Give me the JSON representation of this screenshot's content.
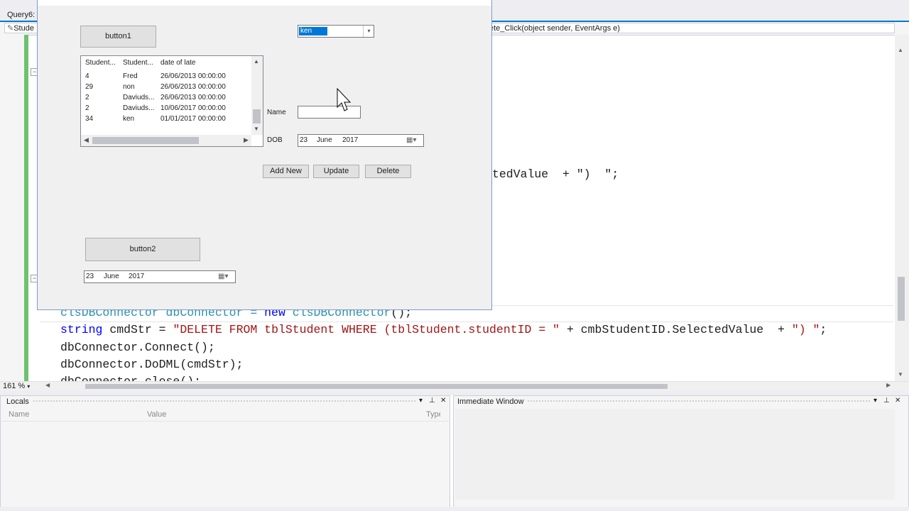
{
  "ide": {
    "tab_title": "Query6: C",
    "nav_left": "Stude",
    "nav_method": "ete_Click(object sender, EventArgs e)",
    "zoom": "161 %",
    "code_line_partial": "tedValue  + \")  \";",
    "code_lines": {
      "l1_var": "clsDBConnector dbConnector = ",
      "l1_new": "new ",
      "l1_type": "clsDBConnector",
      "l1_end": "();",
      "l2_kw": "string",
      "l2_mid": " cmdStr = ",
      "l2_str": "\"DELETE FROM tblStudent WHERE (tblStudent.studentID = \"",
      "l2_mid2": " + cmbStudentID.SelectedValue  + ",
      "l2_str2": "\") \"",
      "l2_end": ";",
      "l3": "dbConnector.Connect();",
      "l4": "dbConnector.DoDML(cmdStr);",
      "l5": "dbConnector.close();"
    }
  },
  "panels": {
    "locals": {
      "title": "Locals",
      "col_name": "Name",
      "col_value": "Value",
      "col_type": "Type"
    },
    "immediate": {
      "title": "Immediate Window"
    },
    "pin_icon": "📌",
    "dropdown_icon": "▾",
    "close_icon": "✕"
  },
  "form": {
    "button1": "button1",
    "button2": "button2",
    "grid": {
      "headers": [
        "Student...",
        "Student...",
        "date of late"
      ],
      "rows": [
        [
          "4",
          "Fred",
          "26/06/2013 00:00:00"
        ],
        [
          "29",
          "non",
          "26/06/2013 00:00:00"
        ],
        [
          "2",
          "Daviuds...",
          "26/06/2013 00:00:00"
        ],
        [
          "2",
          "Daviuds...",
          "10/06/2017 00:00:00"
        ],
        [
          "34",
          "ken",
          "01/01/2017 00:00:00"
        ]
      ]
    },
    "combo_value": "ken",
    "name_label": "Name",
    "name_value": "",
    "dob_label": "DOB",
    "dob": {
      "day": "23",
      "month": "June",
      "year": "2017"
    },
    "dtp2": {
      "day": "23",
      "month": "June",
      "year": "2017"
    },
    "add_new": "Add New",
    "update": "Update",
    "delete": "Delete"
  }
}
